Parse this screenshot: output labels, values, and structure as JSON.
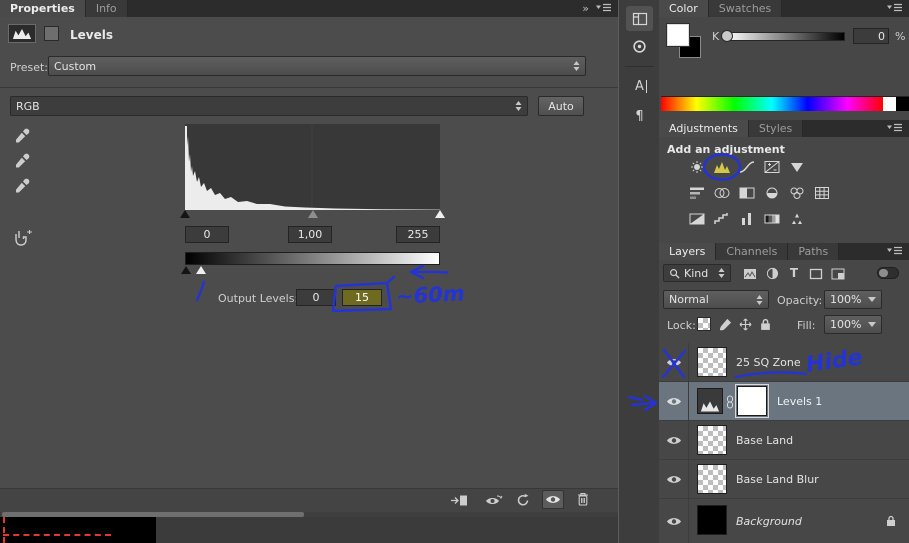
{
  "colors": {
    "annotation_blue": "#2433d6",
    "selected_layer": "#6a7580",
    "highlight_field_bg": "#6e6a1f",
    "panel_bg": "#474747"
  },
  "properties": {
    "tab_properties": "Properties",
    "tab_info": "Info",
    "collapse_glyph": "»",
    "title": "Levels",
    "preset_label": "Preset:",
    "preset_value": "Custom",
    "channel_value": "RGB",
    "auto_label": "Auto",
    "input_shadow": "0",
    "input_midtone": "1,00",
    "input_highlight": "255",
    "output_label": "Output Levels:",
    "output_shadow": "0",
    "output_highlight": "15"
  },
  "dock": {
    "character_glyph": "A",
    "paragraph_glyph": "¶"
  },
  "color_panel": {
    "tab_color": "Color",
    "tab_swatches": "Swatches",
    "k_label": "K",
    "k_value": "0",
    "percent": "%"
  },
  "adjustments_panel": {
    "tab_adjustments": "Adjustments",
    "tab_styles": "Styles",
    "heading": "Add an adjustment"
  },
  "layers_panel": {
    "tab_layers": "Layers",
    "tab_channels": "Channels",
    "tab_paths": "Paths",
    "kind_label": "Kind",
    "type_glyph": "T",
    "blend_mode": "Normal",
    "opacity_label": "Opacity:",
    "opacity_value": "100%",
    "lock_label": "Lock:",
    "fill_label": "Fill:",
    "fill_value": "100%",
    "layers": [
      {
        "name": "25 SQ Zone"
      },
      {
        "name": "Levels 1"
      },
      {
        "name": "Base Land"
      },
      {
        "name": "Base Land Blur"
      },
      {
        "name": "Background"
      }
    ]
  },
  "annotations": {
    "approx_label": "~60m",
    "hide_label": "Hide"
  }
}
